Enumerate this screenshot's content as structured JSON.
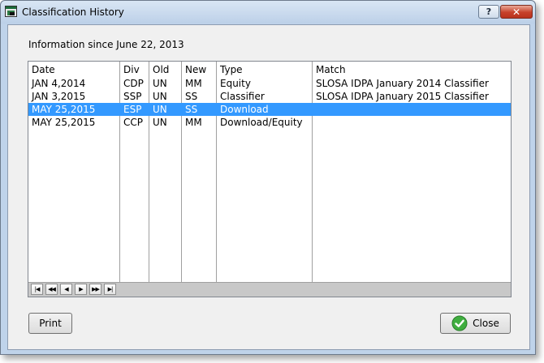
{
  "window": {
    "title": "Classification History",
    "help_label": "?",
    "close_label": "✕"
  },
  "info_text": "Information since June 22, 2013",
  "table": {
    "headers": [
      "Date",
      "Div",
      "Old",
      "New",
      "Type",
      "Match"
    ],
    "rows": [
      {
        "date": "JAN  4,2014",
        "div": "CDP",
        "old": "UN",
        "new": "MM",
        "type": "Equity",
        "match": "SLOSA IDPA January 2014 Classifier",
        "selected": false
      },
      {
        "date": "JAN  3,2015",
        "div": "SSP",
        "old": "UN",
        "new": "SS",
        "type": "Classifier",
        "match": "SLOSA IDPA January 2015 Classifier",
        "selected": false
      },
      {
        "date": "MAY 25,2015",
        "div": "ESP",
        "old": "UN",
        "new": "SS",
        "type": "Download",
        "match": "",
        "selected": true
      },
      {
        "date": "MAY 25,2015",
        "div": "CCP",
        "old": "UN",
        "new": "MM",
        "type": "Download/Equity",
        "match": "",
        "selected": false
      }
    ],
    "selection_color": "#3399ff"
  },
  "navigator": {
    "buttons": [
      {
        "name": "first-record-icon",
        "glyph": "|◀"
      },
      {
        "name": "prior-page-icon",
        "glyph": "◀◀"
      },
      {
        "name": "prior-record-icon",
        "glyph": "◀"
      },
      {
        "name": "next-record-icon",
        "glyph": "▶"
      },
      {
        "name": "next-page-icon",
        "glyph": "▶▶"
      },
      {
        "name": "last-record-icon",
        "glyph": "▶|"
      }
    ]
  },
  "buttons": {
    "print_label": "Print",
    "close_label": "Close"
  },
  "icons": {
    "app": "app-window-icon",
    "close_button": "green-check-icon"
  }
}
